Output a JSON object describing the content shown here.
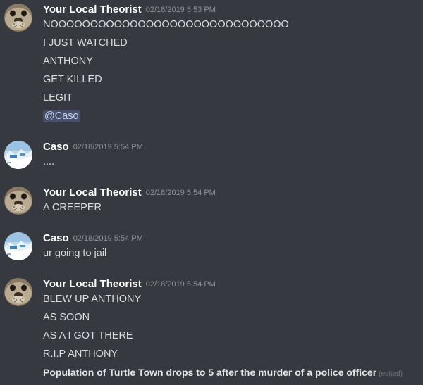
{
  "colors": {
    "background": "#36393f",
    "username": "#ffffff",
    "timestamp": "#8e9297",
    "message_text": "#dcddde",
    "mention_bg": "#414675",
    "mention_text": "#c8d1f5"
  },
  "messages": [
    {
      "author": "Your Local Theorist",
      "timestamp": "02/18/2019 5:53 PM",
      "avatar_icon": "seal-avatar-icon",
      "lines": [
        "NOOOOOOOOOOOOOOOOOOOOOOOOOOOOOO",
        "I JUST WATCHED",
        "ANTHONY",
        "GET KILLED",
        "LEGIT"
      ],
      "mention": "@Caso"
    },
    {
      "author": "Caso",
      "timestamp": "02/18/2019 5:54 PM",
      "avatar_icon": "snowy-landscape-avatar-icon",
      "lines": [
        "...."
      ]
    },
    {
      "author": "Your Local Theorist",
      "timestamp": "02/18/2019 5:54 PM",
      "avatar_icon": "seal-avatar-icon",
      "lines": [
        "A CREEPER"
      ]
    },
    {
      "author": "Caso",
      "timestamp": "02/18/2019 5:54 PM",
      "avatar_icon": "snowy-landscape-avatar-icon",
      "lines": [
        "ur going to jail"
      ]
    },
    {
      "author": "Your Local Theorist",
      "timestamp": "02/18/2019 5:54 PM",
      "avatar_icon": "seal-avatar-icon",
      "lines": [
        "BLEW UP ANTHONY",
        "AS SOON",
        "AS A I GOT THERE",
        "R.I.P ANTHONY"
      ],
      "bold_line": "Population of Turtle Town drops to 5 after the murder of a police officer",
      "edited_label": "(edited)"
    }
  ]
}
